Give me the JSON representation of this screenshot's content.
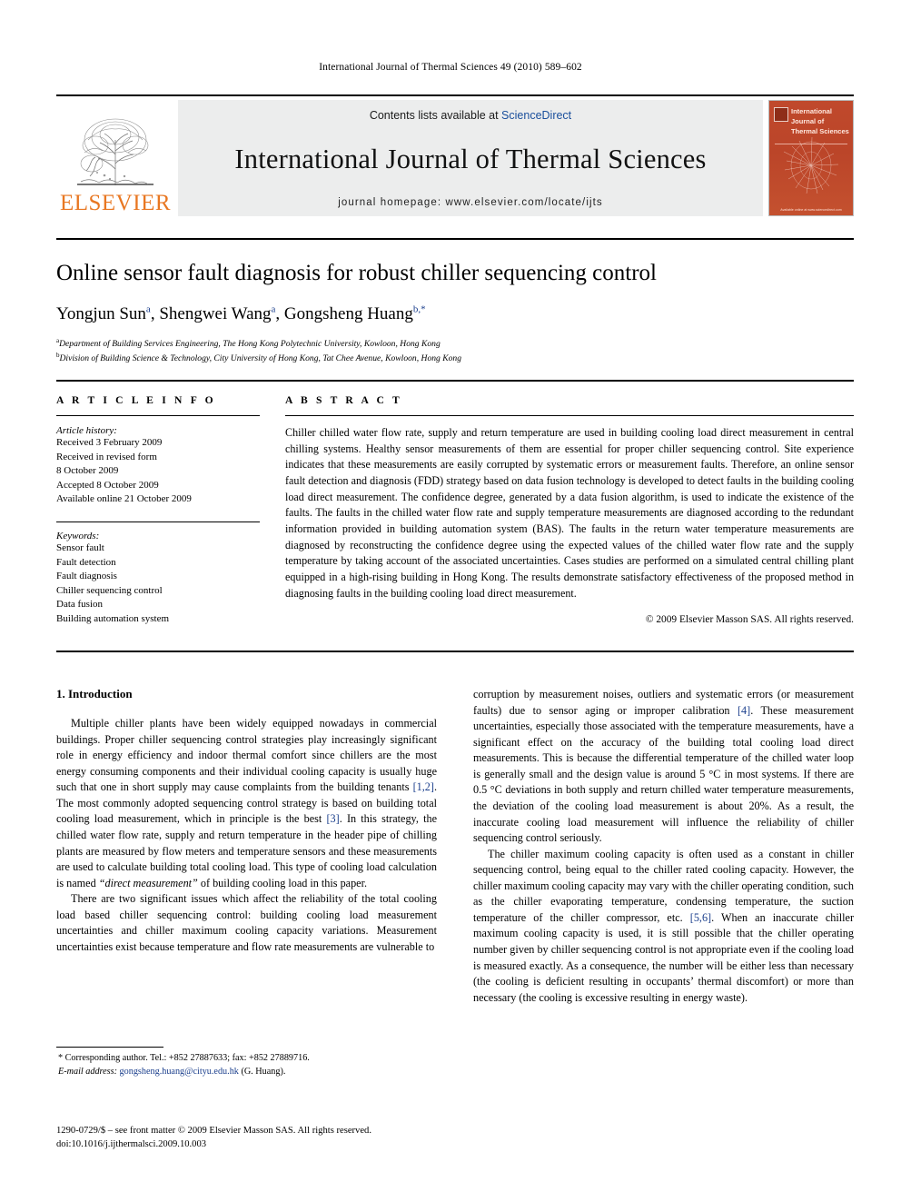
{
  "running_head": "International Journal of Thermal Sciences 49 (2010) 589–602",
  "masthead": {
    "publisher_word": "ELSEVIER",
    "publisher_logo_name": "elsevier-tree-logo",
    "contents_prefix": "Contents lists available at ",
    "contents_link": "ScienceDirect",
    "journal_title": "International Journal of Thermal Sciences",
    "homepage": "journal homepage: www.elsevier.com/locate/ijts",
    "cover_title": "International Journal of Thermal Sciences",
    "cover_footer": "Available online at www.sciencedirect.com",
    "cover_color": "#bb4529",
    "link_color": "#1a4f9c",
    "elsevier_orange": "#E87722"
  },
  "title_block": {
    "title": "Online sensor fault diagnosis for robust chiller sequencing control",
    "authors": [
      {
        "name": "Yongjun Sun",
        "mark": "a",
        "sep": ", "
      },
      {
        "name": "Shengwei Wang",
        "mark": "a",
        "sep": ", "
      },
      {
        "name": "Gongsheng Huang",
        "mark": "b,*",
        "sep": ""
      }
    ],
    "affiliations": [
      {
        "mark": "a",
        "text": "Department of Building Services Engineering, The Hong Kong Polytechnic University, Kowloon, Hong Kong"
      },
      {
        "mark": "b",
        "text": "Division of Building Science & Technology, City University of Hong Kong, Tat Chee Avenue, Kowloon, Hong Kong"
      }
    ]
  },
  "article_info": {
    "heading": "A R T I C L E    I N F O",
    "history_label": "Article history:",
    "history": [
      "Received 3 February 2009",
      "Received in revised form",
      "8 October 2009",
      "Accepted 8 October 2009",
      "Available online 21 October 2009"
    ],
    "keywords_label": "Keywords:",
    "keywords": [
      "Sensor fault",
      "Fault detection",
      "Fault diagnosis",
      "Chiller sequencing control",
      "Data fusion",
      "Building automation system"
    ]
  },
  "abstract": {
    "heading": "A B S T R A C T",
    "text": "Chiller chilled water flow rate, supply and return temperature are used in building cooling load direct measurement in central chilling systems. Healthy sensor measurements of them are essential for proper chiller sequencing control. Site experience indicates that these measurements are easily corrupted by systematic errors or measurement faults. Therefore, an online sensor fault detection and diagnosis (FDD) strategy based on data fusion technology is developed to detect faults in the building cooling load direct measurement. The confidence degree, generated by a data fusion algorithm, is used to indicate the existence of the faults. The faults in the chilled water flow rate and supply temperature measurements are diagnosed according to the redundant information provided in building automation system (BAS). The faults in the return water temperature measurements are diagnosed by reconstructing the confidence degree using the expected values of the chilled water flow rate and the supply temperature by taking account of the associated uncertainties. Cases studies are performed on a simulated central chilling plant equipped in a high-rising building in Hong Kong. The results demonstrate satisfactory effectiveness of the proposed method in diagnosing faults in the building cooling load direct measurement.",
    "copyright": "© 2009 Elsevier Masson SAS. All rights reserved."
  },
  "body": {
    "section_heading": "1. Introduction",
    "left_paragraph_1_a": "Multiple chiller plants have been widely equipped nowadays in commercial buildings. Proper chiller sequencing control strategies play increasingly significant role in energy efficiency and indoor thermal comfort since chillers are the most energy consuming components and their individual cooling capacity is usually huge such that one in short supply may cause complaints from the building tenants ",
    "left_paragraph_1_ref1": "[1,2]",
    "left_paragraph_1_b": ". The most commonly adopted sequencing control strategy is based on building total cooling load measurement, which in principle is the best ",
    "left_paragraph_1_ref2": "[3]",
    "left_paragraph_1_c": ". In this strategy, the chilled water flow rate, supply and return temperature in the header pipe of chilling plants are measured by flow meters and temperature sensors and these measurements are used to calculate building total cooling load. This type of cooling load calculation is named ",
    "left_paragraph_1_italic": "“direct measurement”",
    "left_paragraph_1_d": " of building cooling load in this paper.",
    "left_paragraph_2": "There are two significant issues which affect the reliability of the total cooling load based chiller sequencing control: building cooling load measurement uncertainties and chiller maximum cooling capacity variations. Measurement uncertainties exist because temperature and flow rate measurements are vulnerable to",
    "right_paragraph_1_a": "corruption by measurement noises, outliers and systematic errors (or measurement faults) due to sensor aging or improper calibration ",
    "right_paragraph_1_ref": "[4]",
    "right_paragraph_1_b": ". These measurement uncertainties, especially those associated with the temperature measurements, have a significant effect on the accuracy of the building total cooling load direct measurements. This is because the differential temperature of the chilled water loop is generally small and the design value is around 5 °C in most systems. If there are 0.5 °C deviations in both supply and return chilled water temperature measurements, the deviation of the cooling load measurement is about 20%. As a result, the inaccurate cooling load measurement will influence the reliability of chiller sequencing control seriously.",
    "right_paragraph_2_a": "The chiller maximum cooling capacity is often used as a constant in chiller sequencing control, being equal to the chiller rated cooling capacity. However, the chiller maximum cooling capacity may vary with the chiller operating condition, such as the chiller evaporating temperature, condensing temperature, the suction temperature of the chiller compressor, etc. ",
    "right_paragraph_2_ref": "[5,6]",
    "right_paragraph_2_b": ". When an inaccurate chiller maximum cooling capacity is used, it is still possible that the chiller operating number given by chiller sequencing control is not appropriate even if the cooling load is measured exactly. As a consequence, the number will be either less than necessary (the cooling is deficient resulting in occupants’ thermal discomfort) or more than necessary (the cooling is excessive resulting in energy waste)."
  },
  "footnote": {
    "corresponding": "* Corresponding author. Tel.: +852 27887633; fax: +852 27889716.",
    "email_label": "E-mail address:",
    "email": "gongsheng.huang@cityu.edu.hk",
    "email_suffix": " (G. Huang)."
  },
  "issn_block": {
    "line1": "1290-0729/$ – see front matter © 2009 Elsevier Masson SAS. All rights reserved.",
    "line2": "doi:10.1016/j.ijthermalsci.2009.10.003"
  }
}
